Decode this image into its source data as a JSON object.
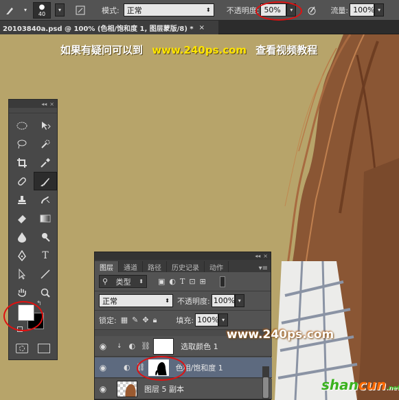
{
  "options_bar": {
    "brush_size": "40",
    "mode_label": "模式:",
    "mode_value": "正常",
    "opacity_label": "不透明度:",
    "opacity_value": "50%",
    "flow_label": "流量:",
    "flow_value": "100%"
  },
  "document_tab": {
    "title": "20103840a.psd @ 100% (色相/饱和度 1, 图层蒙版/8) *",
    "close": "×"
  },
  "promo_banner": {
    "part1": "如果有疑问可以到",
    "url": "www.240ps.com",
    "part2": "查看视频教程"
  },
  "layers_panel": {
    "tabs": [
      "图层",
      "通道",
      "路径",
      "历史记录",
      "动作"
    ],
    "filter_label": "类型",
    "blend_mode": "正常",
    "opacity_label": "不透明度:",
    "opacity_value": "100%",
    "lock_label": "锁定:",
    "fill_label": "填充:",
    "fill_value": "100%",
    "layers": [
      {
        "name": "选取颜色 1"
      },
      {
        "name": "色相/饱和度 1"
      },
      {
        "name": "图层 5 副本"
      }
    ]
  },
  "watermarks": {
    "site": "www.240ps.com",
    "brand_green": "shan",
    "brand_orange": "cun",
    "brand_small": ".net"
  },
  "colors": {
    "canvas": "#b7a46a",
    "promo_yellow": "#ffe400",
    "highlight_ring": "#e01010",
    "active_layer": "#5d6a7f"
  }
}
